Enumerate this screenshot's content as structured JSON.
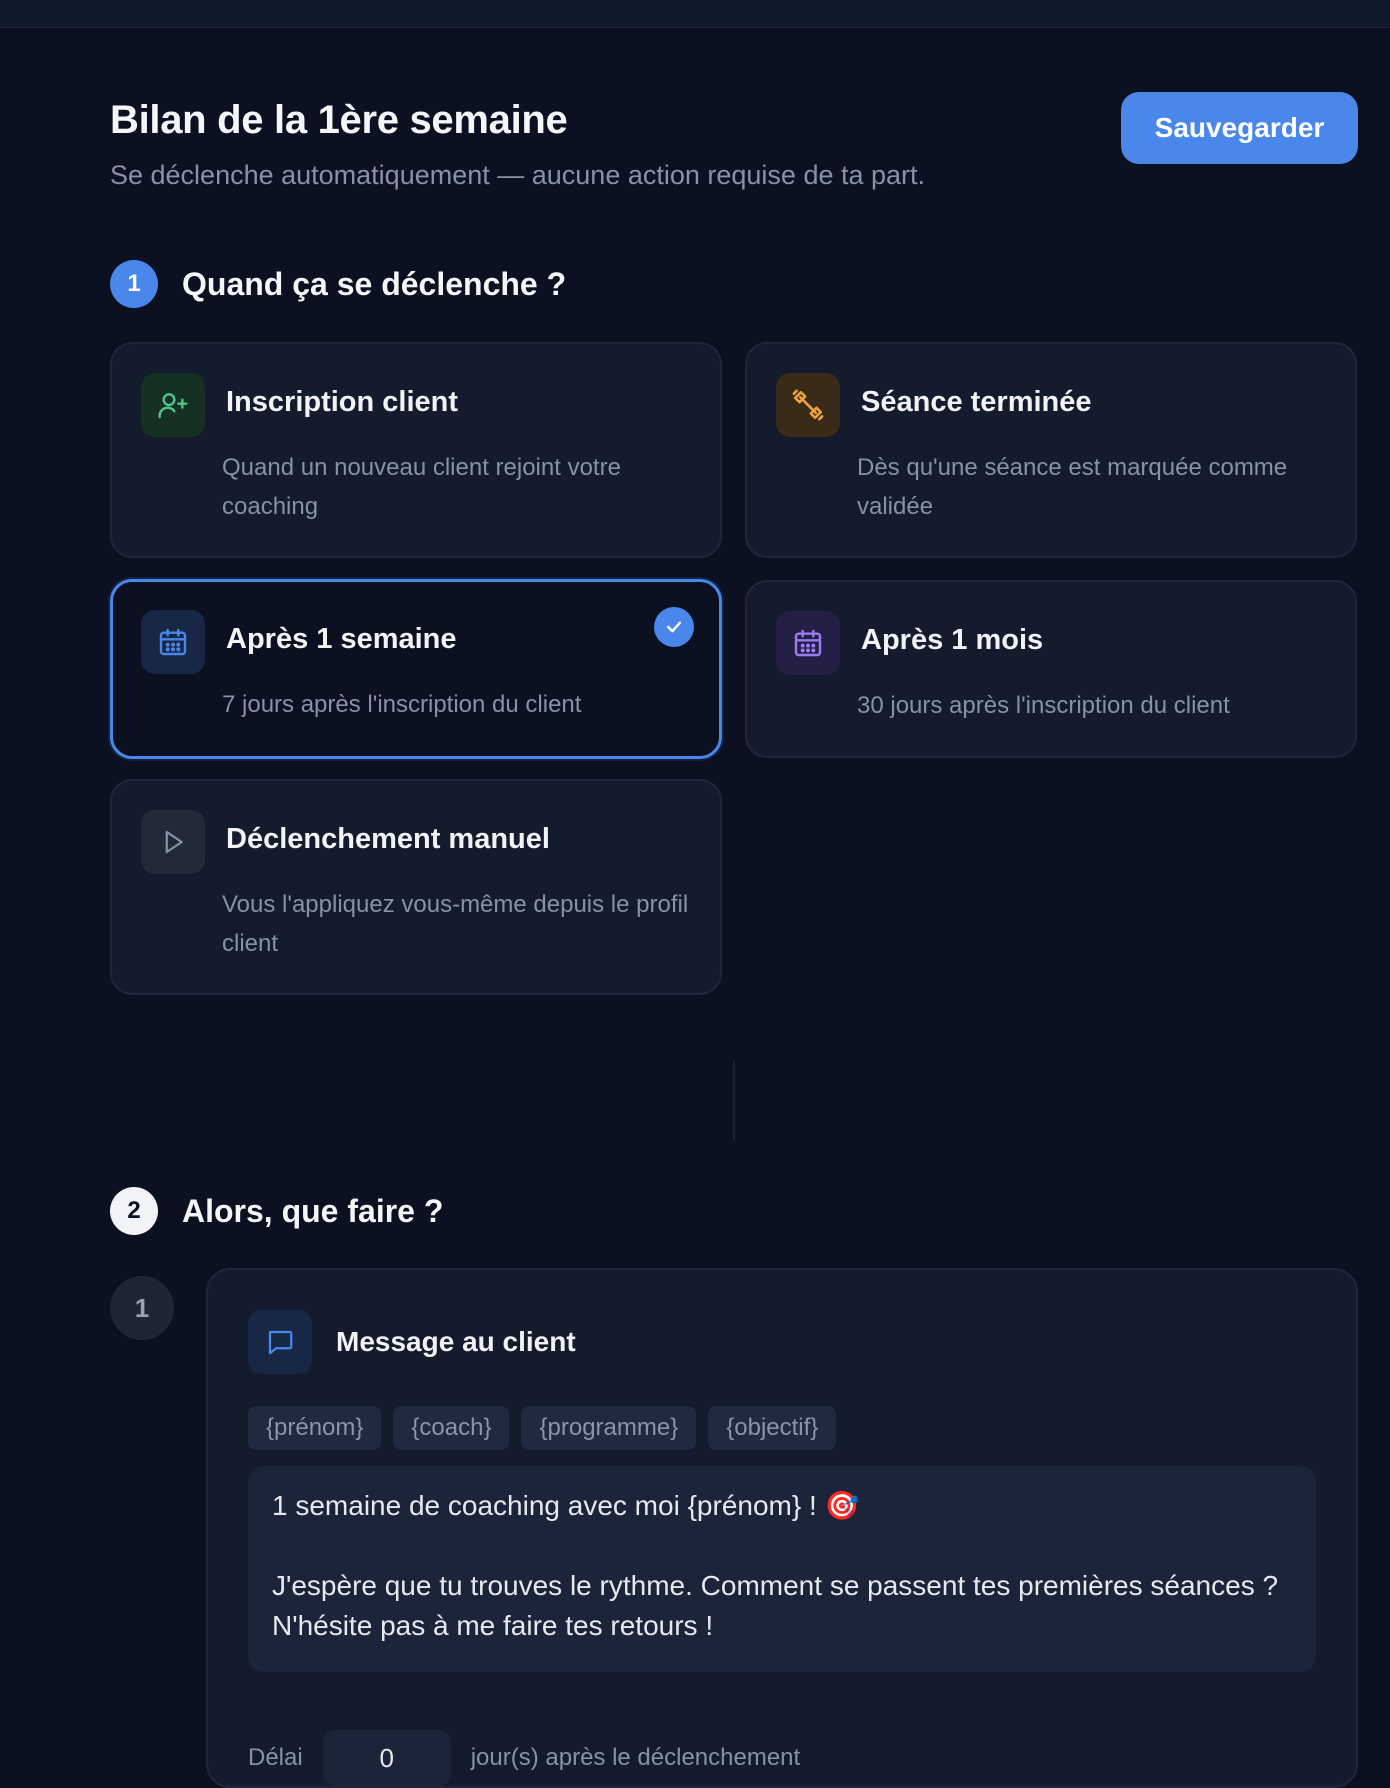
{
  "header": {
    "title": "Bilan de la 1ère semaine",
    "subtitle": "Se déclenche automatiquement — aucune action requise de ta part.",
    "save_label": "Sauvegarder"
  },
  "trigger_step": {
    "number": "1",
    "title": "Quand ça se déclenche ?",
    "options": [
      {
        "icon": "user-plus-icon",
        "title": "Inscription client",
        "description": "Quand un nouveau client rejoint votre coaching",
        "selected": false
      },
      {
        "icon": "dumbbell-icon",
        "title": "Séance terminée",
        "description": "Dès qu'une séance est marquée comme validée",
        "selected": false
      },
      {
        "icon": "calendar-icon",
        "title": "Après 1 semaine",
        "description": "7 jours après l'inscription du client",
        "selected": true
      },
      {
        "icon": "calendar-icon",
        "title": "Après 1 mois",
        "description": "30 jours après l'inscription du client",
        "selected": false
      },
      {
        "icon": "play-icon",
        "title": "Déclenchement manuel",
        "description": "Vous l'appliquez vous-même depuis le profil client",
        "selected": false
      }
    ]
  },
  "action_step": {
    "number": "2",
    "title": "Alors, que faire ?",
    "actions": [
      {
        "number": "1",
        "icon": "message-icon",
        "title": "Message au client",
        "tags": [
          "{prénom}",
          "{coach}",
          "{programme}",
          "{objectif}"
        ],
        "message_line1": "1 semaine de coaching avec moi {prénom} ! 🎯",
        "message_line2": "J'espère que tu trouves le rythme. Comment se passent tes premières séances ? N'hésite pas à me faire tes retours !",
        "delay_prefix": "Délai",
        "delay_value": "0",
        "delay_suffix": "jour(s) après le déclenchement"
      }
    ]
  },
  "colors": {
    "background": "#0b1120",
    "card": "#131b2c",
    "accent": "#4a87ea",
    "green": "#4ec48a",
    "orange": "#f0a23c",
    "purple": "#9b7cf0"
  }
}
